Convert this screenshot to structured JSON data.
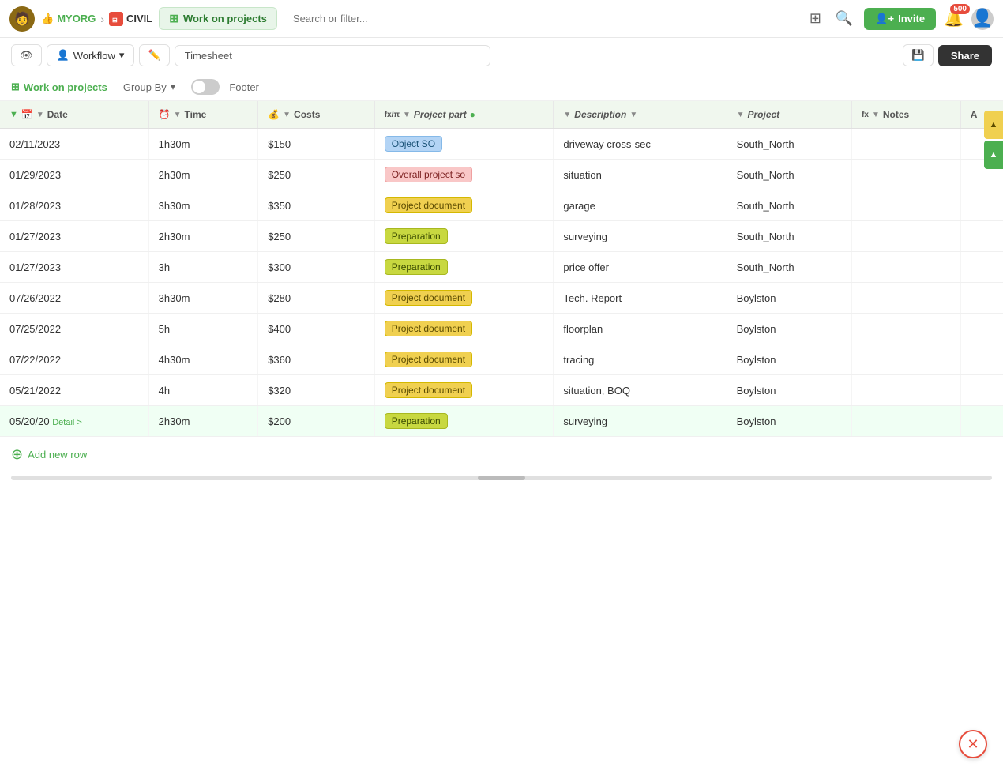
{
  "nav": {
    "myorg_label": "MYORG",
    "civil_label": "CIVIL",
    "project_label": "Work on projects",
    "search_placeholder": "Search or filter...",
    "invite_label": "Invite",
    "notif_count": "500"
  },
  "toolbar": {
    "workflow_label": "Workflow",
    "timesheet_value": "Timesheet",
    "share_label": "Share"
  },
  "subbar": {
    "project_label": "Work on projects",
    "group_by_label": "Group By",
    "footer_label": "Footer"
  },
  "table": {
    "columns": [
      {
        "id": "date",
        "label": "Date",
        "icon": "📅",
        "sort": true,
        "filter": true
      },
      {
        "id": "time",
        "label": "Time",
        "icon": "⏰",
        "sort": false,
        "filter": true
      },
      {
        "id": "costs",
        "label": "Costs",
        "icon": "💰",
        "sort": false,
        "filter": true
      },
      {
        "id": "project_part",
        "label": "Project part",
        "icon": "fx",
        "sort": false,
        "filter": true
      },
      {
        "id": "description",
        "label": "Description",
        "icon": "📝",
        "sort": false,
        "filter": true
      },
      {
        "id": "project",
        "label": "Project",
        "icon": "📁",
        "sort": false,
        "filter": true
      },
      {
        "id": "notes",
        "label": "Notes",
        "icon": "fx",
        "sort": false,
        "filter": true
      },
      {
        "id": "extra",
        "label": "A",
        "icon": "",
        "sort": false,
        "filter": false
      }
    ],
    "rows": [
      {
        "date": "02/11/2023",
        "time": "1h30m",
        "costs": "$150",
        "project_part": "Object SO",
        "project_part_tag": "blue",
        "description": "driveway cross-sec",
        "project": "South_North",
        "notes": "",
        "detail": false
      },
      {
        "date": "01/29/2023",
        "time": "2h30m",
        "costs": "$250",
        "project_part": "Overall project so",
        "project_part_tag": "pink",
        "description": "situation",
        "project": "South_North",
        "notes": "",
        "detail": false
      },
      {
        "date": "01/28/2023",
        "time": "3h30m",
        "costs": "$350",
        "project_part": "Project document",
        "project_part_tag": "yellow",
        "description": "garage",
        "project": "South_North",
        "notes": "",
        "detail": false
      },
      {
        "date": "01/27/2023",
        "time": "2h30m",
        "costs": "$250",
        "project_part": "Preparation",
        "project_part_tag": "olive",
        "description": "surveying",
        "project": "South_North",
        "notes": "",
        "detail": false
      },
      {
        "date": "01/27/2023",
        "time": "3h",
        "costs": "$300",
        "project_part": "Preparation",
        "project_part_tag": "olive",
        "description": "price offer",
        "project": "South_North",
        "notes": "",
        "detail": false
      },
      {
        "date": "07/26/2022",
        "time": "3h30m",
        "costs": "$280",
        "project_part": "Project document",
        "project_part_tag": "yellow",
        "description": "Tech. Report",
        "project": "Boylston",
        "notes": "",
        "detail": false
      },
      {
        "date": "07/25/2022",
        "time": "5h",
        "costs": "$400",
        "project_part": "Project document",
        "project_part_tag": "yellow",
        "description": "floorplan",
        "project": "Boylston",
        "notes": "",
        "detail": false
      },
      {
        "date": "07/22/2022",
        "time": "4h30m",
        "costs": "$360",
        "project_part": "Project document",
        "project_part_tag": "yellow",
        "description": "tracing",
        "project": "Boylston",
        "notes": "",
        "detail": false
      },
      {
        "date": "05/21/2022",
        "time": "4h",
        "costs": "$320",
        "project_part": "Project document",
        "project_part_tag": "yellow",
        "description": "situation, BOQ",
        "project": "Boylston",
        "notes": "",
        "detail": false
      },
      {
        "date": "05/20/20",
        "time": "2h30m",
        "costs": "$200",
        "project_part": "Preparation",
        "project_part_tag": "olive",
        "description": "surveying",
        "project": "Boylston",
        "notes": "",
        "detail": true,
        "highlighted": true
      }
    ],
    "add_row_label": "Add new row"
  },
  "right_tabs": [
    {
      "label": "▲",
      "color": "yellow"
    },
    {
      "label": "▲",
      "color": "blue"
    }
  ],
  "colors": {
    "tag_blue_bg": "#b3d4f5",
    "tag_pink_bg": "#f9c7c7",
    "tag_yellow_bg": "#f0d050",
    "tag_olive_bg": "#c8d840",
    "accent_green": "#4CAF50"
  }
}
